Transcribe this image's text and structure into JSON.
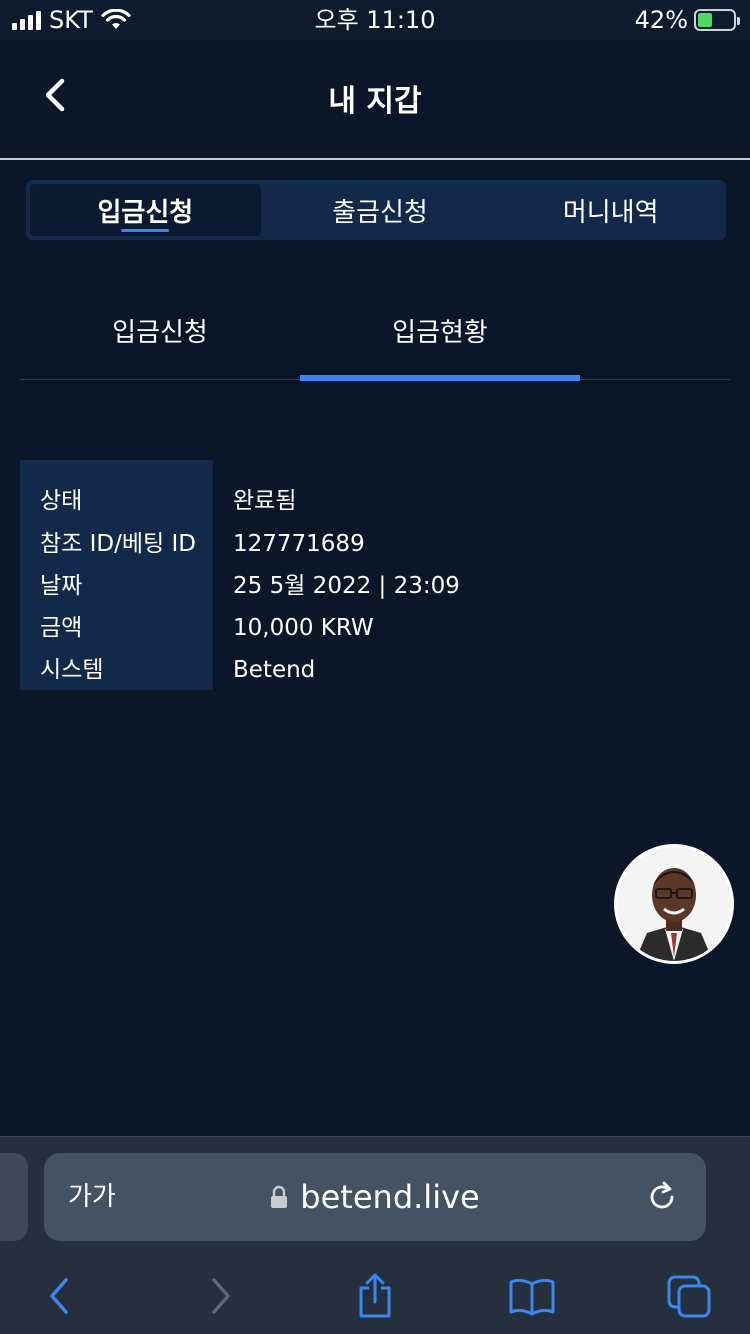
{
  "status_bar": {
    "carrier": "SKT",
    "time": "오후 11:10",
    "battery": "42%",
    "battery_level": 0.42
  },
  "header": {
    "title": "내 지갑",
    "back_icon": "chevron-left-icon"
  },
  "segment_tabs": [
    {
      "label": "입금신청",
      "active": true
    },
    {
      "label": "출금신청",
      "active": false
    },
    {
      "label": "머니내역",
      "active": false
    }
  ],
  "sub_tabs": [
    {
      "label": "입금신청",
      "active": false
    },
    {
      "label": "입금현황",
      "active": true
    }
  ],
  "details": [
    {
      "label": "상태",
      "value": "완료됨"
    },
    {
      "label": "참조 ID/베팅 ID",
      "value": "127771689"
    },
    {
      "label": "날짜",
      "value": "25 5월 2022 | 23:09"
    },
    {
      "label": "금액",
      "value": "10,000 KRW"
    },
    {
      "label": "시스템",
      "value": "Betend"
    }
  ],
  "browser": {
    "text_size_label": "가가",
    "url": "betend.live"
  },
  "colors": {
    "accent": "#3a86f0",
    "background": "#0b1628",
    "panel": "#13294a"
  }
}
